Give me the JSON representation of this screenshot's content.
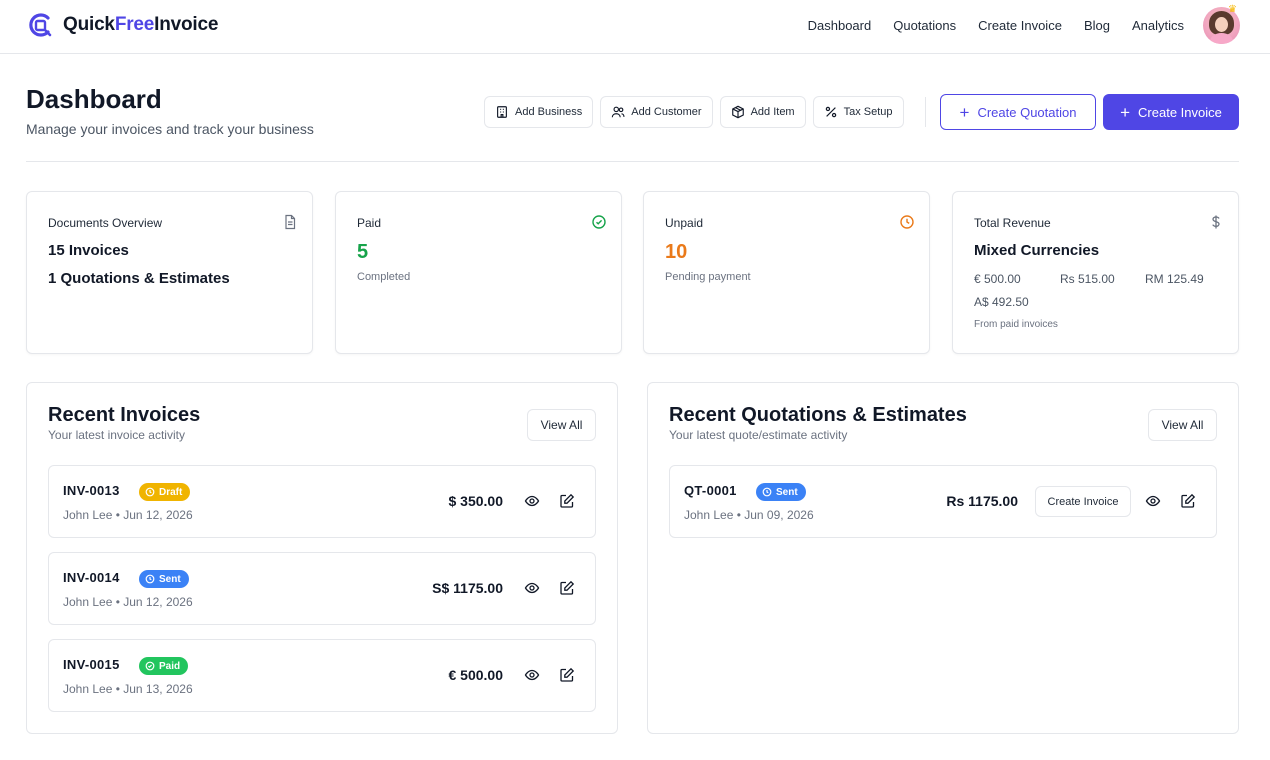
{
  "brand": {
    "name_part1": "Quick",
    "name_part2": "Free",
    "name_part3": "Invoice",
    "accent": "#4f46e5"
  },
  "nav": {
    "links": [
      "Dashboard",
      "Quotations",
      "Create Invoice",
      "Blog",
      "Analytics"
    ]
  },
  "header": {
    "title": "Dashboard",
    "subtitle": "Manage your invoices and track your business",
    "actions": [
      {
        "label": "Add Business",
        "icon": "building-icon"
      },
      {
        "label": "Add Customer",
        "icon": "users-icon"
      },
      {
        "label": "Add Item",
        "icon": "box-icon"
      },
      {
        "label": "Tax Setup",
        "icon": "percent-icon"
      }
    ],
    "create_quotation": "Create Quotation",
    "create_invoice": "Create Invoice",
    "plus_glyph": "+"
  },
  "stats": {
    "documents": {
      "label": "Documents Overview",
      "line1": "15 Invoices",
      "line2": "1 Quotations & Estimates"
    },
    "paid": {
      "label": "Paid",
      "value": "5",
      "note": "Completed",
      "color": "#16a34a"
    },
    "unpaid": {
      "label": "Unpaid",
      "value": "10",
      "note": "Pending payment",
      "color": "#ea7a1a"
    },
    "revenue": {
      "label": "Total Revenue",
      "value": "Mixed Currencies",
      "currencies": [
        "€ 500.00",
        "Rs 515.00",
        "RM 125.49",
        "A$ 492.50"
      ],
      "note": "From paid invoices"
    }
  },
  "invoices_panel": {
    "title": "Recent Invoices",
    "subtitle": "Your latest invoice activity",
    "view_all": "View All",
    "rows": [
      {
        "id": "INV-0013",
        "status": "Draft",
        "status_color": "#f0b400",
        "meta": "John Lee • Jun 12, 2026",
        "amount": "$ 350.00"
      },
      {
        "id": "INV-0014",
        "status": "Sent",
        "status_color": "#3b82f6",
        "meta": "John Lee • Jun 12, 2026",
        "amount": "S$ 1175.00"
      },
      {
        "id": "INV-0015",
        "status": "Paid",
        "status_color": "#22c55e",
        "meta": "John Lee • Jun 13, 2026",
        "amount": "€ 500.00"
      }
    ]
  },
  "quotations_panel": {
    "title": "Recent Quotations & Estimates",
    "subtitle": "Your latest quote/estimate activity",
    "view_all": "View All",
    "rows": [
      {
        "id": "QT-0001",
        "status": "Sent",
        "status_color": "#3b82f6",
        "meta": "John Lee • Jun 09, 2026",
        "amount": "Rs 1175.00",
        "action": "Create Invoice"
      }
    ]
  }
}
